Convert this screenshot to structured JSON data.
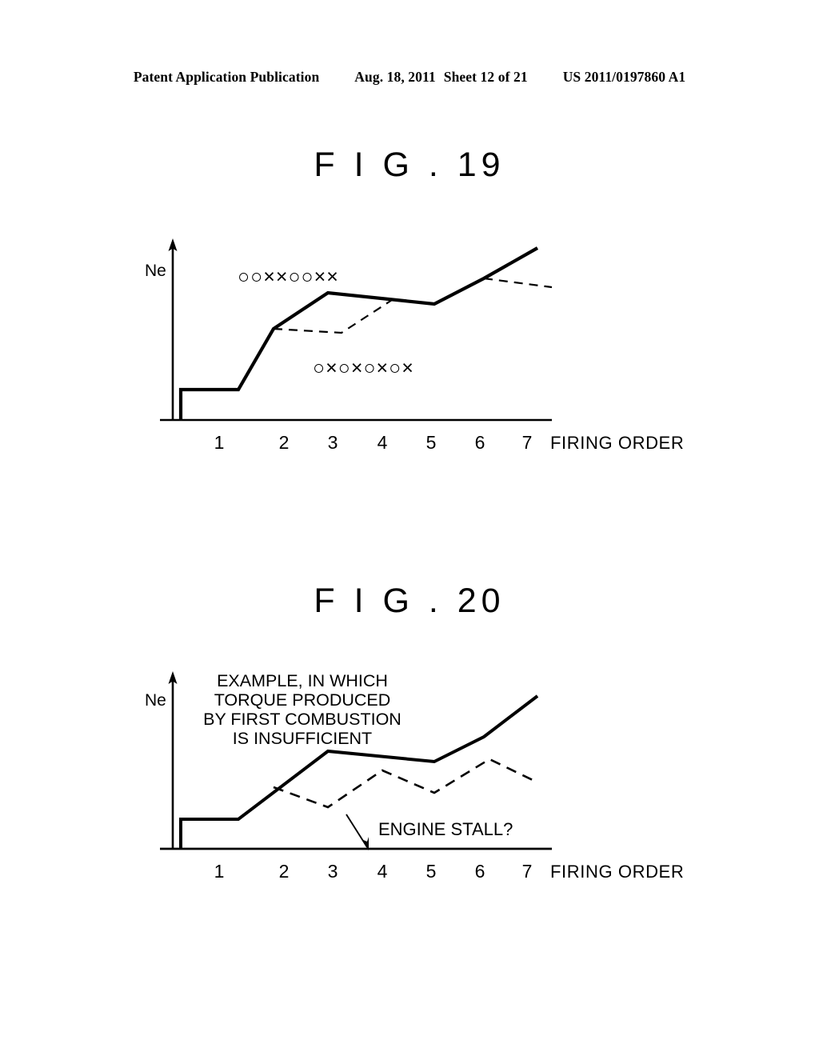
{
  "header": {
    "publication": "Patent Application Publication",
    "date": "Aug. 18, 2011",
    "sheet": "Sheet 12 of 21",
    "patent_number": "US 2011/0197860 A1"
  },
  "figures": [
    {
      "title": "F I G . 19",
      "y_axis_label": "Ne",
      "x_axis_label": "FIRING ORDER",
      "tick_labels": [
        "1",
        "2",
        "3",
        "4",
        "5",
        "6",
        "7"
      ],
      "symbol_rows": [
        {
          "id": "upper",
          "symbols": [
            "○",
            "○",
            "×",
            "×",
            "○",
            "○",
            "×",
            "×"
          ]
        },
        {
          "id": "lower",
          "symbols": [
            "○",
            "×",
            "○",
            "×",
            "○",
            "×",
            "○",
            "×"
          ]
        }
      ]
    },
    {
      "title": "F I G . 20",
      "y_axis_label": "Ne",
      "x_axis_label": "FIRING  ORDER",
      "tick_labels": [
        "1",
        "2",
        "3",
        "4",
        "5",
        "6",
        "7"
      ],
      "note_lines": [
        "EXAMPLE, IN WHICH",
        "TORQUE PRODUCED",
        "BY FIRST COMBUSTION",
        "IS INSUFFICIENT"
      ],
      "stall_label": "ENGINE STALL?"
    }
  ],
  "chart_data": [
    {
      "type": "line",
      "title": "F I G . 19",
      "xlabel": "FIRING ORDER",
      "ylabel": "Ne",
      "xlim": [
        0,
        7.8
      ],
      "ylim": [
        0,
        10
      ],
      "grid": false,
      "legend": "none",
      "series": [
        {
          "name": "engine-speed-solid",
          "style": "solid",
          "x": [
            0.15,
            0.15,
            0.42,
            1.3,
            2.0,
            3.1,
            5.2,
            6.2,
            7.2
          ],
          "y": [
            0.0,
            0.75,
            0.75,
            0.75,
            4.05,
            6.2,
            5.55,
            7.1,
            9.0
          ]
        },
        {
          "name": "engine-speed-dashed-branch-low",
          "style": "dashed",
          "x": [
            2.0,
            3.35,
            4.35
          ],
          "y": [
            4.05,
            3.8,
            5.75
          ]
        },
        {
          "name": "engine-speed-dashed-branch-high",
          "style": "dashed",
          "x": [
            6.2,
            7.55
          ],
          "y": [
            7.1,
            6.55
          ]
        }
      ],
      "annotations": [
        {
          "text": "○○××○○××",
          "x": 1.25,
          "y": 8.5
        },
        {
          "text": "○×○×○×○×",
          "x": 2.7,
          "y": 2.7
        }
      ]
    },
    {
      "type": "line",
      "title": "F I G . 20",
      "xlabel": "FIRING  ORDER",
      "ylabel": "Ne",
      "xlim": [
        0,
        7.8
      ],
      "ylim": [
        0,
        10
      ],
      "grid": false,
      "legend": "none",
      "series": [
        {
          "name": "engine-speed-solid",
          "style": "solid",
          "x": [
            0.15,
            0.15,
            0.42,
            1.3,
            3.1,
            5.2,
            6.2,
            7.2
          ],
          "y": [
            0.0,
            0.75,
            0.75,
            0.75,
            6.2,
            5.55,
            7.1,
            9.0
          ]
        },
        {
          "name": "insufficient-torque-dashed",
          "style": "dashed",
          "x": [
            2.0,
            3.1,
            4.2,
            5.2,
            6.3,
            7.25
          ],
          "y": [
            4.05,
            3.15,
            4.8,
            3.95,
            5.4,
            4.35
          ]
        }
      ],
      "annotations": [
        {
          "text": "EXAMPLE, IN WHICH TORQUE PRODUCED BY FIRST COMBUSTION IS INSUFFICIENT",
          "x": 1.3,
          "y": 9.0
        },
        {
          "text": "ENGINE STALL?",
          "x": 3.9,
          "y": 1.05,
          "arrow_to_x": 3.55,
          "arrow_to_y": 0.0
        }
      ]
    }
  ]
}
